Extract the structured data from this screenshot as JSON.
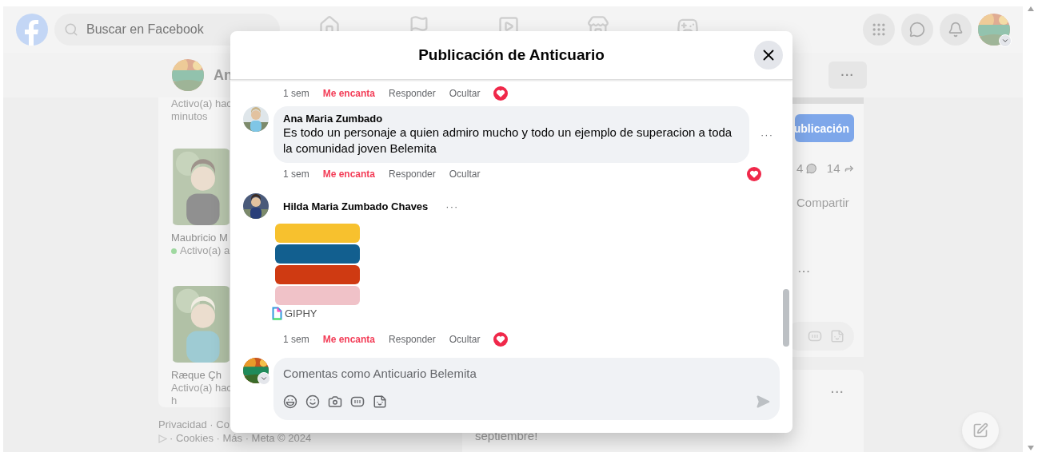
{
  "header": {
    "search_placeholder": "Buscar en Facebook"
  },
  "profile_bar": {
    "name": "An",
    "more": "···"
  },
  "contacts": {
    "lines": [
      "Activo(a) hac",
      "minutos"
    ],
    "people": [
      {
        "name": "Maubricio M",
        "status": [
          "Activo(a) a"
        ],
        "online": true
      },
      {
        "name": "Ræque Çh",
        "status": [
          "Activo(a) hac",
          "h"
        ],
        "online": false
      }
    ]
  },
  "footer": {
    "links": "Privacidad · Co",
    "more": "· Cookies · Más · Meta © 2024"
  },
  "post": {
    "button": "ublicación",
    "comments": "4",
    "shares": "14",
    "action": "Compartir",
    "more": "···"
  },
  "post_2": {
    "more": "···",
    "text": "septiembre!"
  },
  "modal": {
    "title": "Publicación de Anticuario",
    "comments": [
      {
        "kind": "tail",
        "time": "1 sem",
        "reaction": "Me encanta",
        "liked": true,
        "reply": "Responder",
        "hide": "Ocultar",
        "heart": true
      },
      {
        "kind": "text",
        "author": "Ana Maria Zumbado",
        "text": "Es todo un personaje a quien admiro mucho y todo un ejemplo de superacion a toda la comunidad joven Belemita",
        "more": "···",
        "time": "1 sem",
        "reaction": "Me encanta",
        "liked": true,
        "reply": "Responder",
        "hide": "Ocultar",
        "heart": true
      },
      {
        "kind": "gif",
        "author": "Hilda Maria Zumbado Chaves",
        "more": "···",
        "attribution": "GIPHY",
        "time": "1 sem",
        "reaction": "Me encanta",
        "liked": true,
        "reply": "Responder",
        "hide": "Ocultar",
        "heart": true
      }
    ]
  },
  "composer": {
    "placeholder": "Comentas como Anticuario Belemita"
  }
}
